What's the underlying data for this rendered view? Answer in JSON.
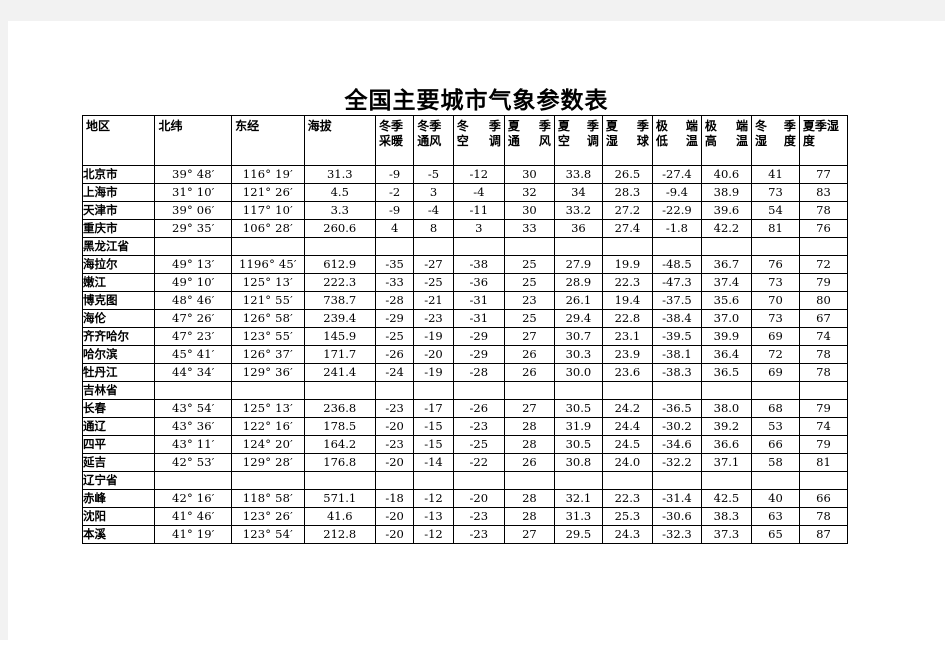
{
  "document": {
    "title": "全国主要城市气象参数表"
  },
  "table": {
    "columns": [
      {
        "key": "region",
        "lines": [
          "地区"
        ],
        "justify": false
      },
      {
        "key": "lat",
        "lines": [
          "北纬"
        ],
        "justify": false
      },
      {
        "key": "lon",
        "lines": [
          "东经"
        ],
        "justify": false
      },
      {
        "key": "alt",
        "lines": [
          "海拔"
        ],
        "justify": false
      },
      {
        "key": "winter_heating",
        "lines": [
          "冬季",
          "采暖"
        ],
        "justify": false
      },
      {
        "key": "winter_vent",
        "lines": [
          "冬季",
          "通风"
        ],
        "justify": false
      },
      {
        "key": "winter_ac",
        "lines": [
          "冬 季",
          "空调"
        ],
        "justify": true
      },
      {
        "key": "summer_vent",
        "lines": [
          "夏 季",
          "通风"
        ],
        "justify": true
      },
      {
        "key": "summer_ac",
        "lines": [
          "夏 季",
          "空调"
        ],
        "justify": true
      },
      {
        "key": "summer_wetbulb",
        "lines": [
          "夏 季",
          "湿球"
        ],
        "justify": true
      },
      {
        "key": "extreme_low",
        "lines": [
          "极 端",
          "低温"
        ],
        "justify": true
      },
      {
        "key": "extreme_high",
        "lines": [
          "极 端",
          "高温"
        ],
        "justify": true
      },
      {
        "key": "winter_humidity",
        "lines": [
          "冬 季",
          "湿度"
        ],
        "justify": true
      },
      {
        "key": "summer_humidity",
        "lines": [
          "夏季湿",
          "度"
        ],
        "justify": false
      }
    ],
    "rows": [
      {
        "type": "city",
        "cells": [
          "北京市",
          "39° 48′",
          "116° 19′",
          "31.3",
          "-9",
          "-5",
          "-12",
          "30",
          "33.8",
          "26.5",
          "-27.4",
          "40.6",
          "41",
          "77"
        ]
      },
      {
        "type": "city",
        "cells": [
          "上海市",
          "31° 10′",
          "121° 26′",
          "4.5",
          "-2",
          "3",
          "-4",
          "32",
          "34",
          "28.3",
          "-9.4",
          "38.9",
          "73",
          "83"
        ]
      },
      {
        "type": "city",
        "cells": [
          "天津市",
          "39° 06′",
          "117° 10′",
          "3.3",
          "-9",
          "-4",
          "-11",
          "30",
          "33.2",
          "27.2",
          "-22.9",
          "39.6",
          "54",
          "78"
        ]
      },
      {
        "type": "city",
        "cells": [
          "重庆市",
          "29° 35′",
          "106° 28′",
          "260.6",
          "4",
          "8",
          "3",
          "33",
          "36",
          "27.4",
          "-1.8",
          "42.2",
          "81",
          "76"
        ]
      },
      {
        "type": "province",
        "cells": [
          "黑龙江省",
          "",
          "",
          "",
          "",
          "",
          "",
          "",
          "",
          "",
          "",
          "",
          "",
          ""
        ]
      },
      {
        "type": "city",
        "cells": [
          "海拉尔",
          "49° 13′",
          "1196° 45′",
          "612.9",
          "-35",
          "-27",
          "-38",
          "25",
          "27.9",
          "19.9",
          "-48.5",
          "36.7",
          "76",
          "72"
        ]
      },
      {
        "type": "city",
        "cells": [
          "嫩江",
          "49° 10′",
          "125° 13′",
          "222.3",
          "-33",
          "-25",
          "-36",
          "25",
          "28.9",
          "22.3",
          "-47.3",
          "37.4",
          "73",
          "79"
        ]
      },
      {
        "type": "city",
        "cells": [
          "博克图",
          "48° 46′",
          "121° 55′",
          "738.7",
          "-28",
          "-21",
          "-31",
          "23",
          "26.1",
          "19.4",
          "-37.5",
          "35.6",
          "70",
          "80"
        ]
      },
      {
        "type": "city",
        "cells": [
          "海伦",
          "47° 26′",
          "126° 58′",
          "239.4",
          "-29",
          "-23",
          "-31",
          "25",
          "29.4",
          "22.8",
          "-38.4",
          "37.0",
          "73",
          "67"
        ]
      },
      {
        "type": "city",
        "cells": [
          "齐齐哈尔",
          "47° 23′",
          "123° 55′",
          "145.9",
          "-25",
          "-19",
          "-29",
          "27",
          "30.7",
          "23.1",
          "-39.5",
          "39.9",
          "69",
          "74"
        ]
      },
      {
        "type": "city",
        "cells": [
          "哈尔滨",
          "45° 41′",
          "126° 37′",
          "171.7",
          "-26",
          "-20",
          "-29",
          "26",
          "30.3",
          "23.9",
          "-38.1",
          "36.4",
          "72",
          "78"
        ]
      },
      {
        "type": "city",
        "cells": [
          "牡丹江",
          "44° 34′",
          "129° 36′",
          "241.4",
          "-24",
          "-19",
          "-28",
          "26",
          "30.0",
          "23.6",
          "-38.3",
          "36.5",
          "69",
          "78"
        ]
      },
      {
        "type": "province",
        "cells": [
          "吉林省",
          "",
          "",
          "",
          "",
          "",
          "",
          "",
          "",
          "",
          "",
          "",
          "",
          ""
        ]
      },
      {
        "type": "city",
        "cells": [
          "长春",
          "43° 54′",
          "125° 13′",
          "236.8",
          "-23",
          "-17",
          "-26",
          "27",
          "30.5",
          "24.2",
          "-36.5",
          "38.0",
          "68",
          "79"
        ]
      },
      {
        "type": "city",
        "cells": [
          "通辽",
          "43° 36′",
          "122° 16′",
          "178.5",
          "-20",
          "-15",
          "-23",
          "28",
          "31.9",
          "24.4",
          "-30.2",
          "39.2",
          "53",
          "74"
        ]
      },
      {
        "type": "city",
        "cells": [
          "四平",
          "43° 11′",
          "124° 20′",
          "164.2",
          "-23",
          "-15",
          "-25",
          "28",
          "30.5",
          "24.5",
          "-34.6",
          "36.6",
          "66",
          "79"
        ]
      },
      {
        "type": "city",
        "cells": [
          "延吉",
          "42° 53′",
          "129° 28′",
          "176.8",
          "-20",
          "-14",
          "-22",
          "26",
          "30.8",
          "24.0",
          "-32.2",
          "37.1",
          "58",
          "81"
        ]
      },
      {
        "type": "province",
        "cells": [
          "辽宁省",
          "",
          "",
          "",
          "",
          "",
          "",
          "",
          "",
          "",
          "",
          "",
          "",
          ""
        ]
      },
      {
        "type": "city",
        "cells": [
          "赤峰",
          "42° 16′",
          "118° 58′",
          "571.1",
          "-18",
          "-12",
          "-20",
          "28",
          "32.1",
          "22.3",
          "-31.4",
          "42.5",
          "40",
          "66"
        ]
      },
      {
        "type": "city",
        "cells": [
          "沈阳",
          "41° 46′",
          "123° 26′",
          "41.6",
          "-20",
          "-13",
          "-23",
          "28",
          "31.3",
          "25.3",
          "-30.6",
          "38.3",
          "63",
          "78"
        ]
      },
      {
        "type": "city",
        "cells": [
          "本溪",
          "41° 19′",
          "123° 54′",
          "212.8",
          "-20",
          "-12",
          "-23",
          "27",
          "29.5",
          "24.3",
          "-32.3",
          "37.3",
          "65",
          "87"
        ]
      }
    ]
  }
}
